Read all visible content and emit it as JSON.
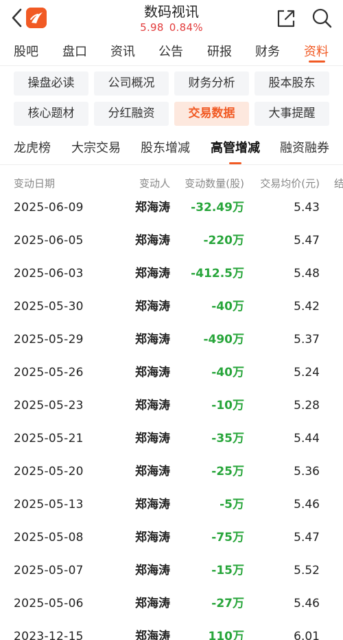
{
  "header": {
    "title": "数码视讯",
    "price": "5.98",
    "change_pct": "0.84%",
    "price_color": "#e23b3b",
    "accent_color": "#f15a24",
    "icons": [
      "back-icon",
      "app-logo-icon",
      "share-icon",
      "search-icon"
    ]
  },
  "main_tabs": [
    {
      "label": "股吧"
    },
    {
      "label": "盘口"
    },
    {
      "label": "资讯"
    },
    {
      "label": "公告"
    },
    {
      "label": "研报"
    },
    {
      "label": "财务"
    },
    {
      "label": "资料",
      "active": true
    }
  ],
  "chips": [
    {
      "label": "操盘必读"
    },
    {
      "label": "公司概况"
    },
    {
      "label": "财务分析"
    },
    {
      "label": "股本股东"
    },
    {
      "label": "核心题材"
    },
    {
      "label": "分红融资"
    },
    {
      "label": "交易数据",
      "active": true
    },
    {
      "label": "大事提醒"
    }
  ],
  "sub_tabs": [
    {
      "label": "龙虎榜"
    },
    {
      "label": "大宗交易"
    },
    {
      "label": "股东增减"
    },
    {
      "label": "高管增减",
      "active": true
    },
    {
      "label": "融资融券"
    }
  ],
  "table": {
    "columns": [
      "变动日期",
      "变动人",
      "变动数量(股)",
      "交易均价(元)",
      "结"
    ],
    "rows": [
      {
        "date": "2025-06-09",
        "person": "郑海涛",
        "qty": "-32.49万",
        "price": "5.43"
      },
      {
        "date": "2025-06-05",
        "person": "郑海涛",
        "qty": "-220万",
        "price": "5.47"
      },
      {
        "date": "2025-06-03",
        "person": "郑海涛",
        "qty": "-412.5万",
        "price": "5.48"
      },
      {
        "date": "2025-05-30",
        "person": "郑海涛",
        "qty": "-40万",
        "price": "5.42"
      },
      {
        "date": "2025-05-29",
        "person": "郑海涛",
        "qty": "-490万",
        "price": "5.37"
      },
      {
        "date": "2025-05-26",
        "person": "郑海涛",
        "qty": "-40万",
        "price": "5.24"
      },
      {
        "date": "2025-05-23",
        "person": "郑海涛",
        "qty": "-10万",
        "price": "5.28"
      },
      {
        "date": "2025-05-21",
        "person": "郑海涛",
        "qty": "-35万",
        "price": "5.44"
      },
      {
        "date": "2025-05-20",
        "person": "郑海涛",
        "qty": "-25万",
        "price": "5.36"
      },
      {
        "date": "2025-05-13",
        "person": "郑海涛",
        "qty": "-5万",
        "price": "5.46"
      },
      {
        "date": "2025-05-08",
        "person": "郑海涛",
        "qty": "-75万",
        "price": "5.47"
      },
      {
        "date": "2025-05-07",
        "person": "郑海涛",
        "qty": "-15万",
        "price": "5.52"
      },
      {
        "date": "2025-05-06",
        "person": "郑海涛",
        "qty": "-27万",
        "price": "5.46"
      },
      {
        "date": "2023-12-15",
        "person": "郑海涛",
        "qty": "110万",
        "price": "6.01"
      }
    ]
  }
}
